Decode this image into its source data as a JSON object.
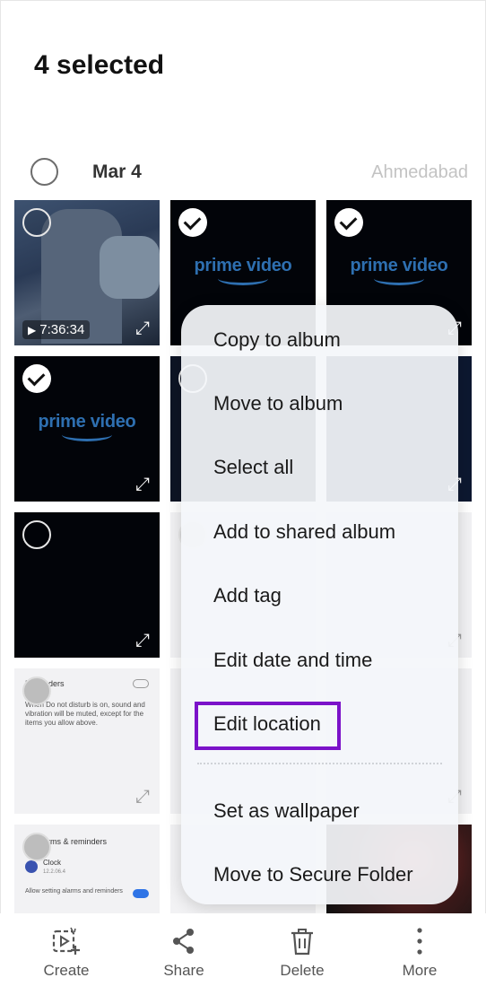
{
  "header": {
    "title": "4 selected"
  },
  "group": {
    "date": "Mar 4",
    "location": "Ahmedabad"
  },
  "thumbnails": {
    "video_duration": "7:36:34",
    "prime_brand": "prime video",
    "reminders_title": "Reminders",
    "reminders_body": "When Do not disturb is on, sound and vibration will be muted, except for the items you allow above.",
    "alarms_title": "Alarms & reminders",
    "clock_label": "Clock",
    "clock_version": "12.2.06.4",
    "allow_text": "Allow setting alarms and reminders"
  },
  "menu": {
    "items": [
      "Copy to album",
      "Move to album",
      "Select all",
      "Add to shared album",
      "Add tag",
      "Edit date and time",
      "Edit location",
      "Set as wallpaper",
      "Move to Secure Folder"
    ],
    "highlighted_index": 6
  },
  "bottom_bar": {
    "items": [
      {
        "label": "Create",
        "icon": "create-movie-icon"
      },
      {
        "label": "Share",
        "icon": "share-icon"
      },
      {
        "label": "Delete",
        "icon": "trash-icon"
      },
      {
        "label": "More",
        "icon": "more-vertical-icon"
      }
    ]
  },
  "colors": {
    "highlight": "#7b12c9",
    "prime_blue": "#2e6fb0"
  }
}
